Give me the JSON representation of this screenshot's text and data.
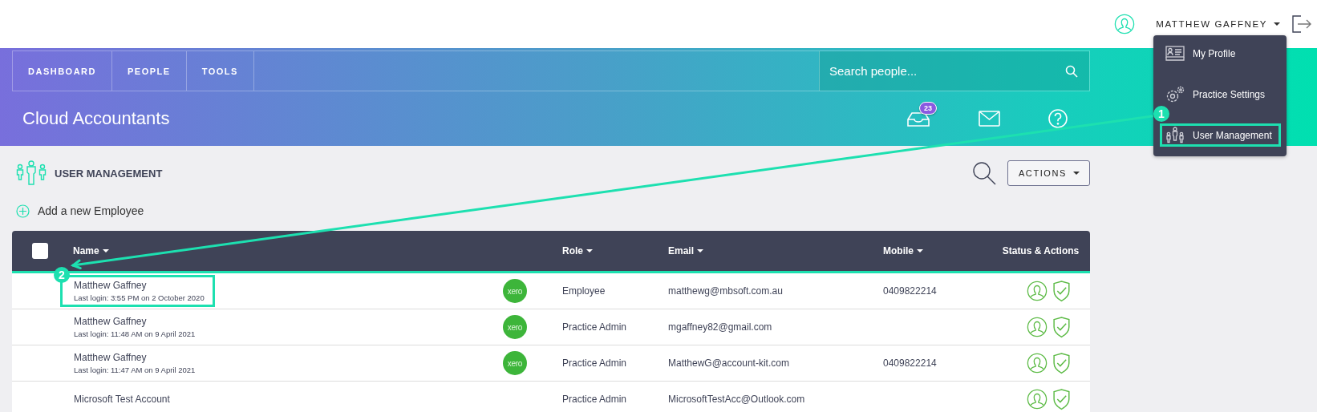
{
  "user_bar": {
    "user_name": "MATTHEW GAFFNEY"
  },
  "user_menu": {
    "items": [
      {
        "kind": "profile",
        "label": "My Profile",
        "highlighted": false
      },
      {
        "kind": "settings",
        "label": "Practice Settings",
        "highlighted": false
      },
      {
        "kind": "users",
        "label": "User Management",
        "highlighted": true
      }
    ]
  },
  "nav": {
    "tabs": [
      {
        "label": "DASHBOARD"
      },
      {
        "label": "PEOPLE"
      },
      {
        "label": "TOOLS"
      }
    ]
  },
  "search": {
    "placeholder": "Search people..."
  },
  "practice_title": "Cloud Accountants",
  "notifications": {
    "badge": "23"
  },
  "section": {
    "title": "USER MANAGEMENT",
    "actions_button": "ACTIONS"
  },
  "add_employee": "Add a new Employee",
  "table": {
    "select_all_checked": false,
    "columns": [
      {
        "label": "Name",
        "sortable": true
      },
      {
        "label": "Role",
        "sortable": true
      },
      {
        "label": "Email",
        "sortable": true
      },
      {
        "label": "Mobile",
        "sortable": true
      },
      {
        "label": "Status & Actions",
        "sortable": false
      }
    ],
    "rows": [
      {
        "name": "Matthew Gaffney",
        "last_login": "Last login: 3:55 PM on 2 October 2020",
        "integration": "xero",
        "role": "Employee",
        "email": "matthewg@mbsoft.com.au",
        "mobile": "0409822214",
        "highlighted": true
      },
      {
        "name": "Matthew Gaffney",
        "last_login": "Last login: 11:48 AM on 9 April 2021",
        "integration": "xero",
        "role": "Practice Admin",
        "email": "mgaffney82@gmail.com",
        "highlighted": false
      },
      {
        "name": "Matthew Gaffney",
        "last_login": "Last login: 11:47 AM on 9 April 2021",
        "integration": "xero",
        "role": "Practice Admin",
        "email": "MatthewG@account-kit.com",
        "mobile": "0409822214",
        "highlighted": false
      },
      {
        "name": "Microsoft Test Account",
        "role": "Practice Admin",
        "email": "MicrosoftTestAcc@Outlook.com",
        "highlighted": false
      }
    ]
  },
  "annotations": [
    {
      "label": "1"
    },
    {
      "label": "2"
    }
  ]
}
